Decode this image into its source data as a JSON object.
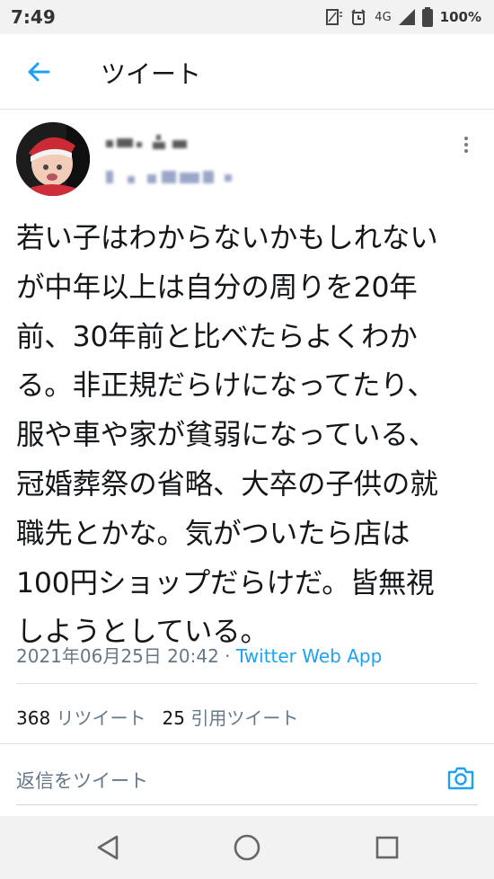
{
  "status_bar": {
    "time": "7:49",
    "network": "4G",
    "battery": "100%",
    "icons": [
      "screenshot-icon",
      "alarm-icon",
      "signal-icon",
      "battery-icon"
    ]
  },
  "app_bar": {
    "title": "ツイート",
    "back_icon": "arrow-left-icon",
    "accent": "#1da1f2"
  },
  "tweet": {
    "text_lines": [
      "若い子はわからないかもしれない",
      "が中年以上は自分の周りを20年",
      "前、30年前と比べたらよくわか",
      "る。非正規だらけになってたり、",
      "服や車や家が貧弱になっている、",
      "冠婚葬祭の省略、大卒の子供の就",
      "職先とかな。気がついたら店は",
      "100円ショップだらけだ。皆無視",
      "しようとしている。"
    ],
    "timestamp": "2021年06月25日 20:42",
    "separator": " · ",
    "source": "Twitter Web App"
  },
  "stats": {
    "retweets_count": "368",
    "retweets_label": "リツイート",
    "quotes_count": "25",
    "quotes_label": "引用ツイート"
  },
  "reply": {
    "placeholder": "返信をツイート",
    "camera_icon": "camera-icon"
  },
  "nav_bar": {
    "back": "back-triangle-icon",
    "home": "home-circle-icon",
    "recents": "recents-square-icon"
  }
}
